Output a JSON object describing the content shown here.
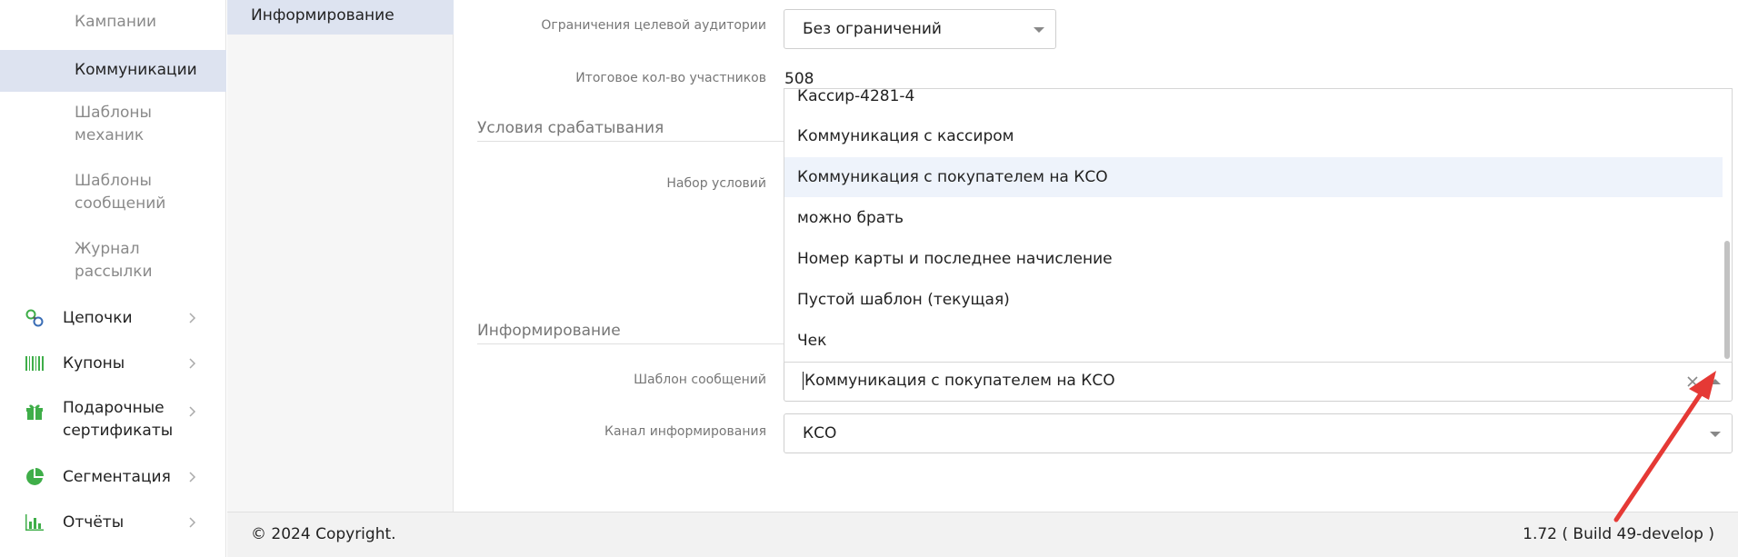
{
  "sidebar": {
    "sub_items": [
      {
        "label": "Кампании",
        "active": false
      },
      {
        "label": "Коммуникации",
        "active": true
      },
      {
        "label": "Шаблоны механик",
        "active": false
      },
      {
        "label": "Шаблоны сообщений",
        "active": false
      },
      {
        "label": "Журнал рассылки",
        "active": false
      }
    ],
    "main_items": [
      {
        "label": "Цепочки",
        "icon": "chain-icon"
      },
      {
        "label": "Купоны",
        "icon": "barcode-icon"
      },
      {
        "label": "Подарочные сертификаты",
        "icon": "gift-icon"
      },
      {
        "label": "Сегментация",
        "icon": "pie-chart-icon"
      },
      {
        "label": "Отчёты",
        "icon": "bar-chart-icon"
      }
    ]
  },
  "midcol": {
    "active_item": "Информирование"
  },
  "form": {
    "audience_label": "Ограничения целевой аудитории",
    "audience_value": "Без ограничений",
    "participants_label": "Итоговое кол-во участников",
    "participants_value": "508",
    "conditions_section": "Условия срабатывания",
    "conditions_label": "Набор условий",
    "informing_section": "Информирование",
    "template_label": "Шаблон сообщений",
    "template_value": "Коммуникация с покупателем на КСО",
    "channel_label": "Канал информирования",
    "channel_value": "КСО"
  },
  "dropdown": {
    "options": [
      "Кассир-4281-4",
      "Коммуникация с кассиром",
      "Коммуникация с покупателем на КСО",
      "можно брать",
      "Номер карты и последнее начисление",
      "Пустой шаблон (текущая)",
      "Чек"
    ],
    "highlighted_index": 2
  },
  "footer": {
    "copyright": "© 2024 Copyright.",
    "version": "1.72 ( Build 49-develop )"
  },
  "colors": {
    "accent_green": "#3fae49",
    "active_bg": "#dde3f0",
    "annotation_red": "#e53935"
  }
}
